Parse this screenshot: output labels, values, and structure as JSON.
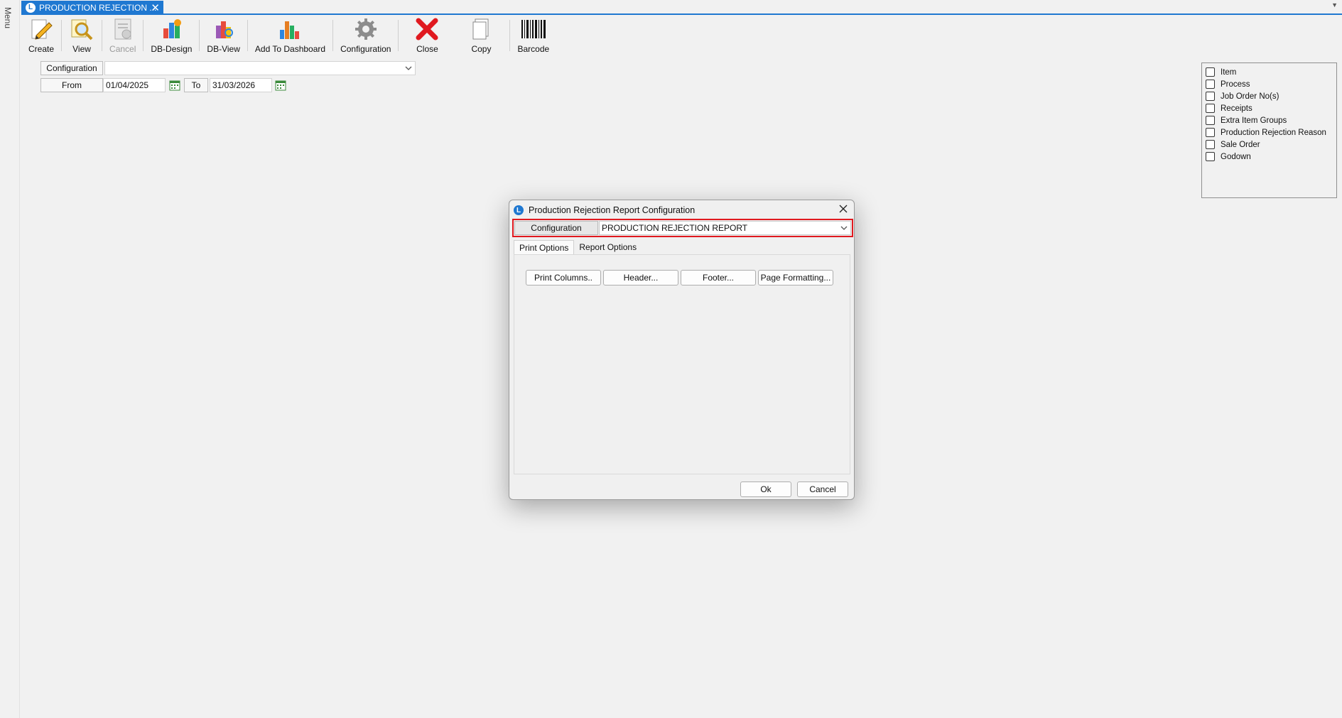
{
  "menu": {
    "label": "Menu"
  },
  "tab": {
    "title": "PRODUCTION REJECTION ...",
    "close_glyph": "✕"
  },
  "toolbar": {
    "buttons": [
      {
        "label": "Create",
        "icon": "pencil-icon"
      },
      {
        "label": "View",
        "icon": "magnifier-icon"
      },
      {
        "label": "Cancel",
        "icon": "cancel-doc-icon"
      },
      {
        "label": "DB-Design",
        "icon": "db-design-icon"
      },
      {
        "label": "DB-View",
        "icon": "db-view-icon"
      },
      {
        "label": "Add To Dashboard",
        "icon": "bar-chart-icon"
      },
      {
        "label": "Configuration",
        "icon": "gear-icon"
      },
      {
        "label": "Close",
        "icon": "red-x-icon"
      },
      {
        "label": "Copy",
        "icon": "copy-icon"
      },
      {
        "label": "Barcode",
        "icon": "barcode-icon"
      }
    ]
  },
  "filters": {
    "configuration_label": "Configuration",
    "configuration_value": "",
    "from_label": "From",
    "from_value": "01/04/2025",
    "to_label": "To",
    "to_value": "31/03/2026"
  },
  "filter_panel": {
    "items": [
      "Item",
      "Process",
      "Job Order No(s)",
      "Receipts",
      "Extra Item Groups",
      "Production Rejection Reason",
      "Sale Order",
      "Godown"
    ]
  },
  "dialog": {
    "title": "Production Rejection Report Configuration",
    "configuration_label": "Configuration",
    "configuration_value": "PRODUCTION REJECTION REPORT",
    "tabs": [
      "Print Options",
      "Report Options"
    ],
    "buttons": [
      "Print Columns..",
      "Header...",
      "Footer...",
      "Page Formatting..."
    ],
    "ok_label": "Ok",
    "cancel_label": "Cancel"
  },
  "colors": {
    "accent": "#1f78d1",
    "highlight": "#e0191f"
  }
}
